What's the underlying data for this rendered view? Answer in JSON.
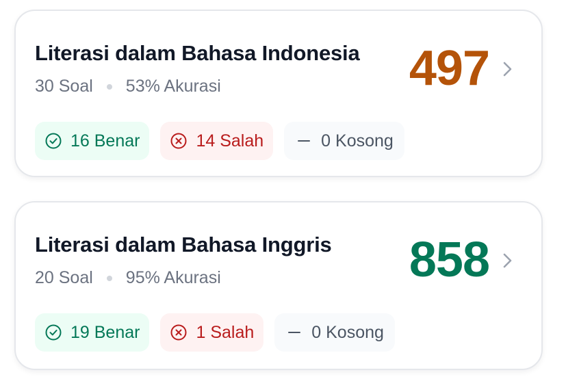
{
  "colors": {
    "score_low": "#b45309",
    "score_high": "#047857",
    "correct": "#047857",
    "wrong": "#b91c1c",
    "empty": "#4b5563"
  },
  "cards": [
    {
      "title": "Literasi dalam Bahasa Indonesia",
      "questions": "30 Soal",
      "accuracy": "53% Akurasi",
      "score": "497",
      "correct": "16 Benar",
      "wrong": "14 Salah",
      "empty": "0 Kosong"
    },
    {
      "title": "Literasi dalam Bahasa Inggris",
      "questions": "20 Soal",
      "accuracy": "95% Akurasi",
      "score": "858",
      "correct": "19 Benar",
      "wrong": "1 Salah",
      "empty": "0 Kosong"
    }
  ],
  "icons": {
    "correct": "check-circle-icon",
    "wrong": "x-circle-icon",
    "empty": "minus-icon",
    "open": "chevron-right-icon"
  }
}
